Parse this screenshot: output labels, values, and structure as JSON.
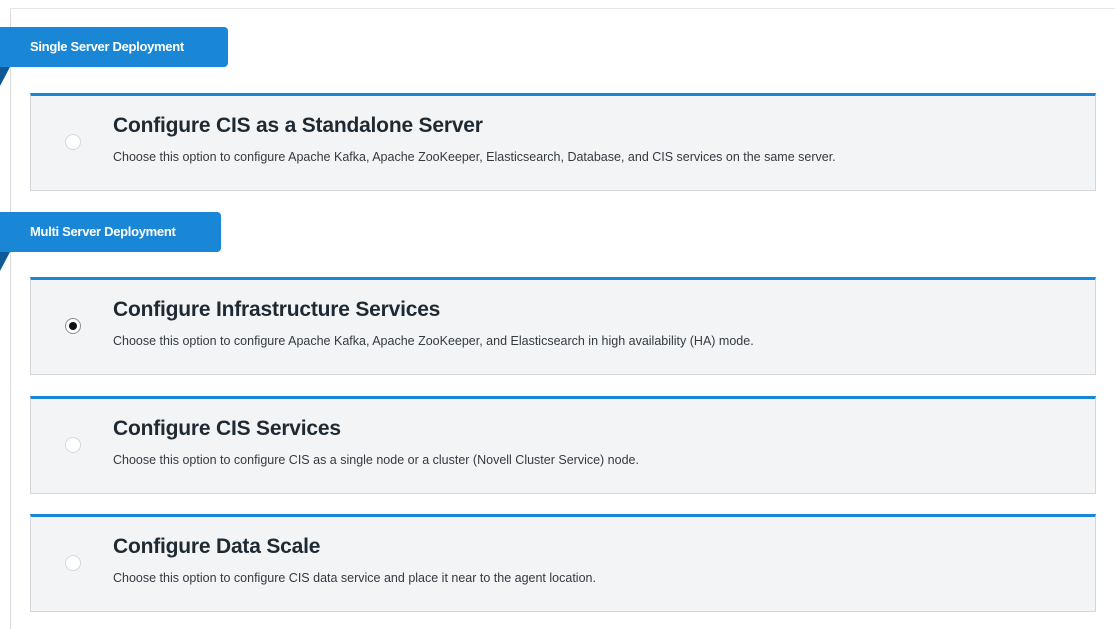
{
  "sections": [
    {
      "label": "Single Server Deployment",
      "options": [
        {
          "title": "Configure CIS as a Standalone Server",
          "description": "Choose this option to configure Apache Kafka, Apache ZooKeeper, Elasticsearch, Database, and CIS services on the same server.",
          "selected": false
        }
      ]
    },
    {
      "label": "Multi Server Deployment",
      "options": [
        {
          "title": "Configure Infrastructure Services",
          "description": "Choose this option to configure Apache Kafka, Apache ZooKeeper, and Elasticsearch in high availability (HA) mode.",
          "selected": true
        },
        {
          "title": "Configure CIS Services",
          "description": "Choose this option to configure CIS as a single node or a cluster (Novell Cluster Service) node.",
          "selected": false
        },
        {
          "title": "Configure Data Scale",
          "description": "Choose this option to configure CIS data service and place it near to the agent location.",
          "selected": false
        }
      ]
    }
  ],
  "colors": {
    "accent": "#1a87d6",
    "tag_fold": "#0f5a96",
    "card_background": "#f3f4f6"
  }
}
